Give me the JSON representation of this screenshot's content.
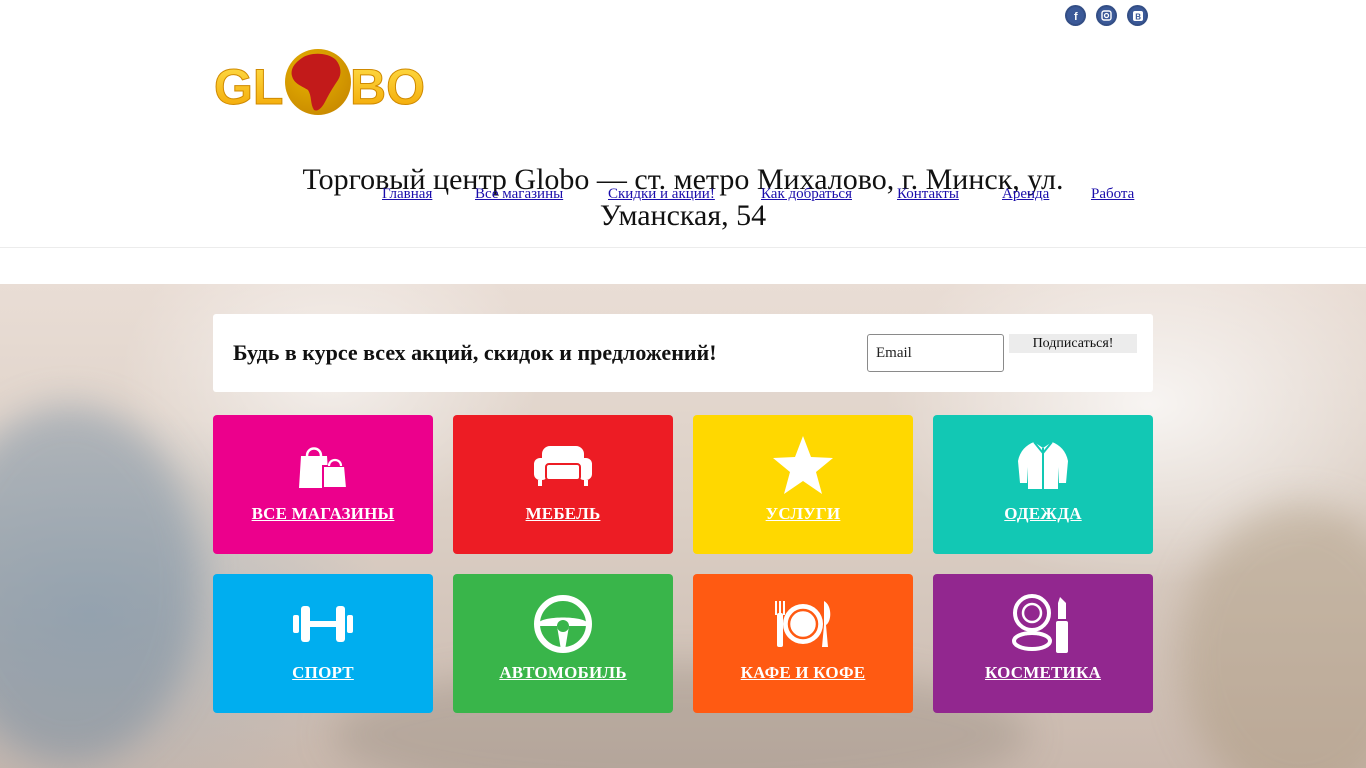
{
  "social": [
    {
      "name": "facebook",
      "glyph": "f"
    },
    {
      "name": "instagram",
      "glyph": ""
    },
    {
      "name": "vkontakte",
      "glyph": "B"
    }
  ],
  "logo": {
    "text": "GLOBO",
    "colors": {
      "gold": "#f6b800",
      "globe": "#c21a1a"
    }
  },
  "site_title": "Торговый центр Globo — ст. метро Михалово, г. Минск, ул. Уманская, 54",
  "nav": [
    "Главная",
    "Все магазины",
    "Скидки и акции!",
    "Как добраться",
    "Контакты",
    "Аренда",
    "Работа"
  ],
  "subscribe": {
    "heading": "Будь в курсе всех акций, скидок и предложений!",
    "email_placeholder": "Email",
    "button_label": "Подписаться!"
  },
  "categories": [
    {
      "label": "Все магазины",
      "icon": "shopping-bags-icon",
      "color": "#ec008c"
    },
    {
      "label": "Мебель",
      "icon": "sofa-icon",
      "color": "#ed1c24"
    },
    {
      "label": "Услуги",
      "icon": "star-icon",
      "color": "#ffd800"
    },
    {
      "label": "Одежда",
      "icon": "jacket-icon",
      "color": "#12c8b4"
    },
    {
      "label": "Спорт",
      "icon": "dumbbell-icon",
      "color": "#00aeef"
    },
    {
      "label": "Автомобиль",
      "icon": "steering-wheel-icon",
      "color": "#39b54a"
    },
    {
      "label": "Кафе и кофе",
      "icon": "plate-cutlery-icon",
      "color": "#ff5a12"
    },
    {
      "label": "Косметика",
      "icon": "cosmetics-icon",
      "color": "#92278f"
    }
  ]
}
